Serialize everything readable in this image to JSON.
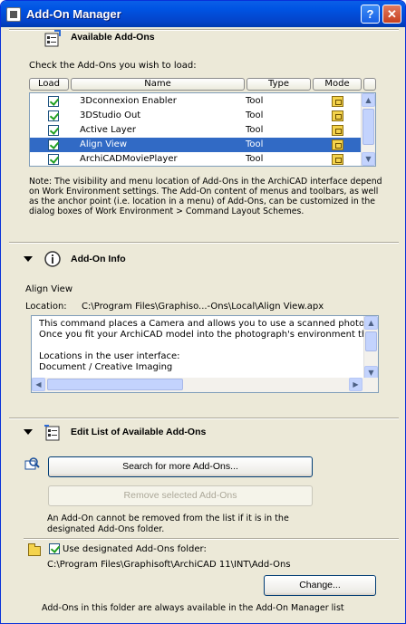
{
  "window": {
    "title": "Add-On Manager",
    "help_button": "?",
    "close_button": "✕"
  },
  "available": {
    "title": "Available Add-Ons",
    "instruction": "Check the Add-Ons you wish to load:",
    "columns": {
      "load": "Load",
      "name": "Name",
      "type": "Type",
      "mode": "Mode"
    },
    "rows": [
      {
        "name": "3Dconnexion Enabler",
        "type": "Tool",
        "checked": true,
        "selected": false
      },
      {
        "name": "3DStudio Out",
        "type": "Tool",
        "checked": true,
        "selected": false
      },
      {
        "name": "Active Layer",
        "type": "Tool",
        "checked": true,
        "selected": false
      },
      {
        "name": "Align View",
        "type": "Tool",
        "checked": true,
        "selected": true
      },
      {
        "name": "ArchiCADMoviePlayer",
        "type": "Tool",
        "checked": true,
        "selected": false
      }
    ],
    "note_lines": [
      "Note: The visibility and menu location of Add-Ons in the ArchiCAD interface depend",
      "on Work Environment settings. The Add-On content of menus and toolbars, as well",
      "as the anchor point (i.e. location in a menu) of Add-Ons, can be customized in the",
      "dialog boxes of Work Environment > Command Layout Schemes."
    ]
  },
  "info": {
    "title": "Add-On Info",
    "addon_name": "Align View",
    "location_label": "Location:",
    "location_value": "C:\\Program Files\\Graphiso...-Ons\\Local\\Align View.apx",
    "description_lines": [
      "This command places a Camera and allows you to use a scanned photogra",
      "Once you fit your ArchiCAD model into the photograph's environment the",
      "",
      "Locations in the user interface:",
      "Document / Creative Imaging"
    ]
  },
  "edit": {
    "title": "Edit List of Available Add-Ons",
    "search_button": "Search for more Add-Ons...",
    "remove_button": "Remove selected Add-Ons",
    "remove_note_lines": [
      "An Add-On cannot be removed from the list if it is in the",
      "designated Add-Ons folder."
    ],
    "use_folder_label": "Use designated Add-Ons folder:",
    "folder_path": "C:\\Program Files\\Graphisoft\\ArchiCAD 11\\INT\\Add-Ons",
    "change_button": "Change...",
    "folder_note": "Add-Ons in this folder are always available in the Add-On Manager list"
  }
}
